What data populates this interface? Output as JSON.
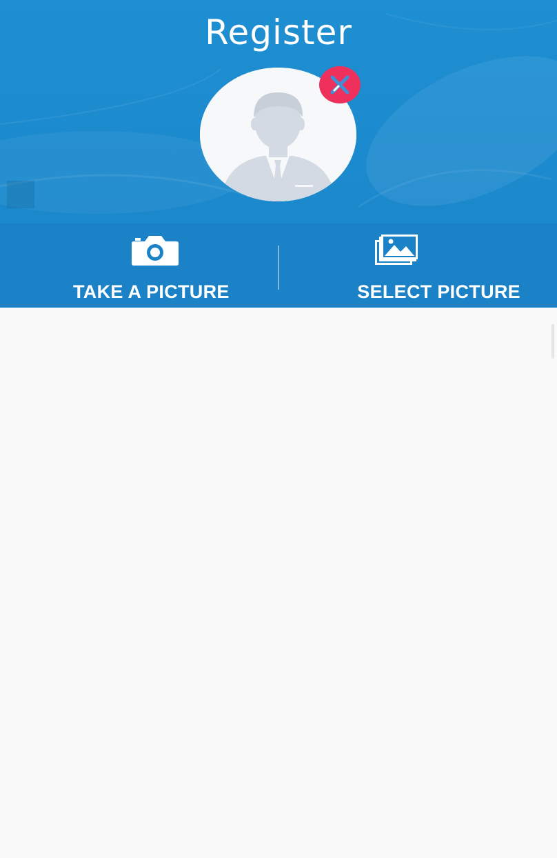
{
  "header": {
    "title": "Register"
  },
  "avatar": {
    "icon": "person-avatar-icon",
    "remove_icon": "close-icon"
  },
  "actions": [
    {
      "label": "TAKE A PICTURE",
      "icon": "camera-icon"
    },
    {
      "label": "SELECT PICTURE",
      "icon": "gallery-icon"
    }
  ],
  "colors": {
    "header_bg": "#1e8fd2",
    "actions_bg": "#1b82c8",
    "remove_badge": "#ef2f5c",
    "content_bg": "#f9f9f9"
  }
}
